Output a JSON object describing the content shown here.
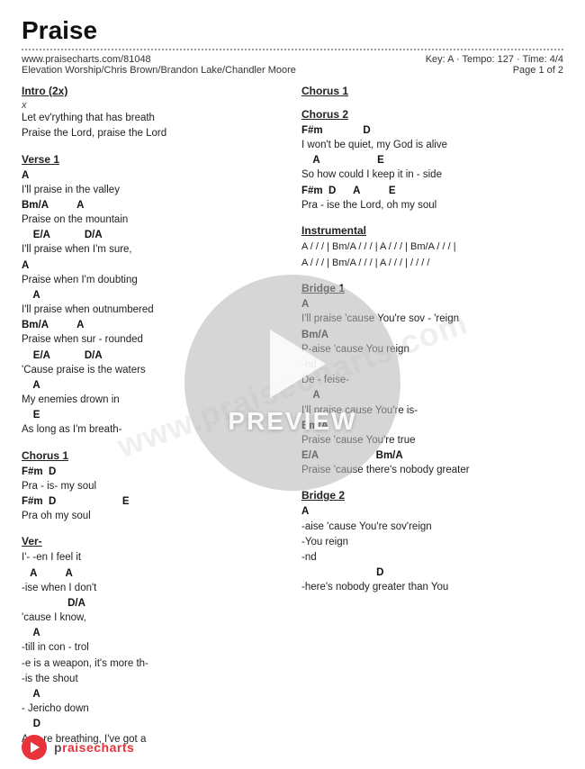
{
  "header": {
    "title": "Praise",
    "url": "www.praisecharts.com/81048",
    "key": "Key: A",
    "tempo": "Tempo: 127",
    "time": "Time: 4/4",
    "page": "Page 1 of 2",
    "authors": "Elevation Worship/Chris Brown/Brandon Lake/Chandler Moore"
  },
  "left_column": {
    "sections": [
      {
        "id": "intro",
        "title": "Intro (2x)",
        "lines": [
          {
            "type": "x",
            "text": "x"
          },
          {
            "type": "lyric",
            "text": "Let ev'rything that has breath"
          },
          {
            "type": "lyric",
            "text": "Praise the Lord, praise the Lord"
          }
        ]
      },
      {
        "id": "verse1",
        "title": "Verse 1",
        "lines": [
          {
            "type": "chord",
            "text": "A"
          },
          {
            "type": "lyric",
            "text": "I'll praise in the valley"
          },
          {
            "type": "chord",
            "text": "Bm/A          A"
          },
          {
            "type": "lyric",
            "text": "Praise on the mountain"
          },
          {
            "type": "chord",
            "text": "    E/A            D/A"
          },
          {
            "type": "lyric",
            "text": "I'll praise when I'm sure,"
          },
          {
            "type": "chord",
            "text": "A"
          },
          {
            "type": "lyric",
            "text": "Praise when I'm doubting"
          },
          {
            "type": "chord",
            "text": "    A"
          },
          {
            "type": "lyric",
            "text": "I'll praise when outnumbered"
          },
          {
            "type": "chord",
            "text": "Bm/A          A"
          },
          {
            "type": "lyric",
            "text": "Praise when sur - rounded"
          },
          {
            "type": "chord",
            "text": "    E/A            D/A"
          },
          {
            "type": "lyric",
            "text": "'Cause praise is the waters"
          },
          {
            "type": "chord",
            "text": "    A"
          },
          {
            "type": "lyric",
            "text": "My enemies drown in"
          },
          {
            "type": "chord",
            "text": "    E"
          },
          {
            "type": "lyric",
            "text": "As long as I'm breath-"
          }
        ]
      },
      {
        "id": "chorus1-left",
        "title": "Chorus 1",
        "lines": [
          {
            "type": "chord",
            "text": "F#m  D"
          },
          {
            "type": "lyric",
            "text": "Pra - is-                   my soul"
          },
          {
            "type": "chord",
            "text": "F#m  D                       E"
          },
          {
            "type": "lyric",
            "text": "Pra                oh my soul"
          }
        ]
      },
      {
        "id": "verse2-partial",
        "title": "Ver-",
        "lines": [
          {
            "type": "lyric",
            "text": "I'-           -en I feel it"
          },
          {
            "type": "chord",
            "text": "   A          A"
          },
          {
            "type": "lyric",
            "text": "-ise when I don't"
          },
          {
            "type": "chord",
            "text": "                D/A"
          },
          {
            "type": "lyric",
            "text": "'cause I know,"
          },
          {
            "type": "chord",
            "text": "    A"
          },
          {
            "type": "lyric",
            "text": "-till in con - trol"
          },
          {
            "type": "lyric",
            "text": "-e is a weapon, it's more th-"
          },
          {
            "type": "lyric",
            "text": "-is the shout"
          },
          {
            "type": "chord",
            "text": "    A"
          },
          {
            "type": "lyric",
            "text": "- Jericho down"
          },
          {
            "type": "chord",
            "text": "    D"
          },
          {
            "type": "lyric",
            "text": "As-        -re breathing, I've got a"
          }
        ]
      }
    ]
  },
  "right_column": {
    "sections": [
      {
        "id": "chorus1-right",
        "title": "Chorus 1",
        "lines": []
      },
      {
        "id": "chorus2",
        "title": "Chorus 2",
        "lines": [
          {
            "type": "chord",
            "text": "F#m              D"
          },
          {
            "type": "lyric",
            "text": "I  won't be quiet, my God is alive"
          },
          {
            "type": "chord",
            "text": "    A                    E"
          },
          {
            "type": "lyric",
            "text": "So how could I keep it in - side"
          },
          {
            "type": "chord",
            "text": "F#m  D      A          E"
          },
          {
            "type": "lyric",
            "text": "Pra - ise the Lord, oh my soul"
          }
        ]
      },
      {
        "id": "instrumental",
        "title": "Instrumental",
        "lines": [
          {
            "type": "instrumental",
            "text": "A / / / | Bm/A / / / | A / / / | Bm/A / / / |"
          },
          {
            "type": "instrumental",
            "text": "A / / / | Bm/A / / / | A / / / | / / / /"
          }
        ]
      },
      {
        "id": "bridge1",
        "title": "Bridge 1",
        "lines": [
          {
            "type": "chord",
            "text": "A"
          },
          {
            "type": "lyric",
            "text": "I'll praise 'cause You're sov - 'reign"
          },
          {
            "type": "chord",
            "text": "Bm/A"
          },
          {
            "type": "lyric",
            "text": "P-aise 'cause You reign"
          },
          {
            "type": "lyric",
            "text": "-nd"
          },
          {
            "type": "lyric",
            "text": "De - feise-"
          },
          {
            "type": "chord",
            "text": "    A"
          },
          {
            "type": "lyric",
            "text": "I'll praise cause You're is-"
          },
          {
            "type": "chord",
            "text": "Bm/A"
          },
          {
            "type": "lyric",
            "text": "Praise 'cause You're true"
          },
          {
            "type": "chord",
            "text": "E/A                    Bm/A"
          },
          {
            "type": "lyric",
            "text": "Praise 'cause there's nobody greater"
          }
        ]
      },
      {
        "id": "bridge2",
        "title": "Bridge 2",
        "lines": [
          {
            "type": "chord",
            "text": "A"
          },
          {
            "type": "lyric",
            "text": "-aise 'cause You're sov'reign"
          },
          {
            "type": "lyric",
            "text": "-You reign"
          },
          {
            "type": "lyric",
            "text": "-nd"
          },
          {
            "type": "chord",
            "text": "                          D"
          },
          {
            "type": "lyric",
            "text": "-here's nobody greater than You"
          }
        ]
      }
    ]
  },
  "preview": {
    "text": "PREVIEW",
    "play_label": "play"
  },
  "watermark": {
    "text": "www.praisecharts.com"
  },
  "footer": {
    "brand": "praisecharts"
  }
}
